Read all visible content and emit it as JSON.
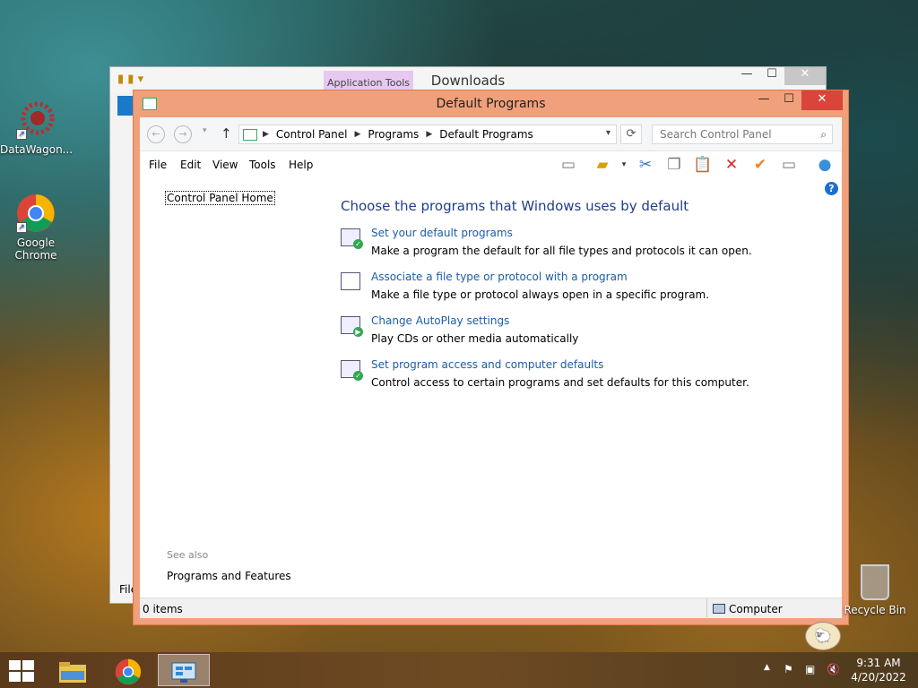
{
  "desktop": {
    "icons": [
      {
        "label": "DataWagon...",
        "icon": "datawagon-icon"
      },
      {
        "label": "Google Chrome",
        "icon": "chrome-icon"
      },
      {
        "label": "Recycle Bin",
        "icon": "recycle-bin-icon"
      }
    ]
  },
  "bg_window": {
    "title": "Downloads",
    "ribbon_context": "Application Tools",
    "file_label": "File"
  },
  "window": {
    "title": "Default Programs",
    "controls": {
      "minimize": "—",
      "maximize": "☐",
      "close": "✕"
    },
    "address": {
      "crumbs": [
        "Control Panel",
        "Programs",
        "Default Programs"
      ]
    },
    "search": {
      "placeholder": "Search Control Panel"
    },
    "menu": [
      "File",
      "Edit",
      "View",
      "Tools",
      "Help"
    ],
    "toolbar_icons": [
      "layout-pane-icon",
      "folder-options-icon",
      "cut-icon",
      "copy-icon",
      "paste-icon",
      "delete-icon",
      "properties-check-icon",
      "rename-icon",
      "globe-icon"
    ],
    "sidebar": {
      "home_link": "Control Panel Home",
      "see_also_label": "See also",
      "see_also_link": "Programs and Features"
    },
    "main": {
      "heading": "Choose the programs that Windows uses by default",
      "tasks": [
        {
          "link": "Set your default programs",
          "desc": "Make a program the default for all file types and protocols it can open."
        },
        {
          "link": "Associate a file type or protocol with a program",
          "desc": "Make a file type or protocol always open in a specific program."
        },
        {
          "link": "Change AutoPlay settings",
          "desc": "Play CDs or other media automatically"
        },
        {
          "link": "Set program access and computer defaults",
          "desc": "Control access to certain programs and set defaults for this computer."
        }
      ]
    },
    "status": {
      "items": "0 items",
      "location": "Computer"
    }
  },
  "taskbar": {
    "clock_time": "9:31 AM",
    "clock_date": "4/20/2022",
    "tray_icons": [
      "show-hidden-icons-icon",
      "action-center-flag-icon",
      "network-icon",
      "volume-muted-icon"
    ]
  }
}
